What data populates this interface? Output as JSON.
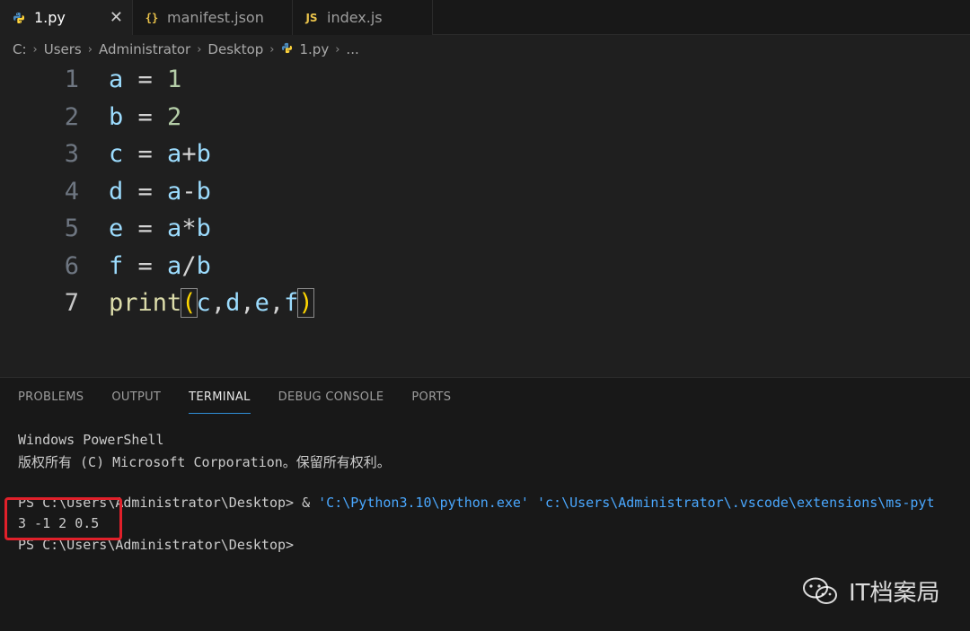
{
  "tabs": [
    {
      "label": "1.py",
      "icon": "python-icon",
      "active": true
    },
    {
      "label": "manifest.json",
      "icon": "json-icon",
      "active": false
    },
    {
      "label": "index.js",
      "icon": "js-icon",
      "active": false
    }
  ],
  "tab_close_glyph": "✕",
  "json_glyph": "{}",
  "js_glyph": "JS",
  "breadcrumb": [
    "C:",
    "Users",
    "Administrator",
    "Desktop",
    "1.py",
    "..."
  ],
  "editor": {
    "lines": [
      {
        "num": "1",
        "text": "a = 1"
      },
      {
        "num": "2",
        "text": "b = 2"
      },
      {
        "num": "3",
        "text": "c = a+b"
      },
      {
        "num": "4",
        "text": "d = a-b"
      },
      {
        "num": "5",
        "text": "e = a*b"
      },
      {
        "num": "6",
        "text": "f = a/b"
      },
      {
        "num": "7",
        "text": "print(c,d,e,f)"
      }
    ]
  },
  "panel": {
    "tabs": [
      "PROBLEMS",
      "OUTPUT",
      "TERMINAL",
      "DEBUG CONSOLE",
      "PORTS"
    ],
    "active_tab": "TERMINAL"
  },
  "terminal": {
    "header1": "Windows PowerShell",
    "header2": "版权所有 (C) Microsoft Corporation。保留所有权利。",
    "prompt1": "PS C:\\Users\\Administrator\\Desktop>",
    "cmd_amp": " & ",
    "cmd": "'C:\\Python3.10\\python.exe' 'c:\\Users\\Administrator\\.vscode\\extensions\\ms-pyt",
    "output": "3 -1 2 0.5",
    "prompt2": "PS C:\\Users\\Administrator\\Desktop>"
  },
  "watermark": {
    "text": "IT档案局",
    "icon": "wechat-icon"
  },
  "colors": {
    "highlight_box": "#e0202a",
    "accent": "#2f8fd8"
  }
}
